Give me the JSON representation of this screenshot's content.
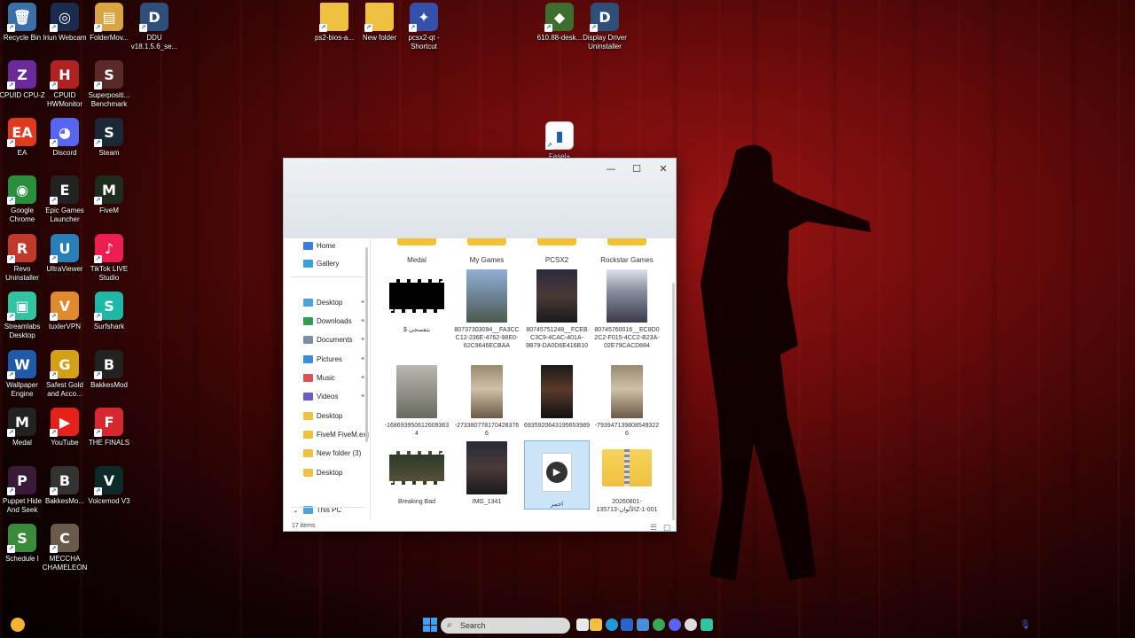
{
  "desktop": {
    "icons": [
      {
        "label": "Recycle Bin",
        "color": "#3b6fa8",
        "glyph": "🗑"
      },
      {
        "label": "Iriun Webcam",
        "color": "#1a2b4d",
        "glyph": "◎"
      },
      {
        "label": "FolderMov...",
        "color": "#d9a441",
        "glyph": "▤"
      },
      {
        "label": "DDU v18.1.5.6_se...",
        "color": "#2d4f7a",
        "glyph": "D"
      },
      {
        "label": "ps2-bios-a...",
        "color": "#f0c040",
        "glyph": ""
      },
      {
        "label": "New folder",
        "color": "#f0c040",
        "glyph": ""
      },
      {
        "label": "pcsx2-qt - Shortcut",
        "color": "#3450a8",
        "glyph": "✦"
      },
      {
        "label": "610.88-desk...",
        "color": "#3d6e2e",
        "glyph": "◆"
      },
      {
        "label": "Display Driver Uninstaller",
        "color": "#2d4f7a",
        "glyph": "D"
      },
      {
        "label": "CPUID CPU-Z",
        "color": "#6a2a9a",
        "glyph": "Z"
      },
      {
        "label": "CPUID HWMonitor",
        "color": "#b02222",
        "glyph": "H"
      },
      {
        "label": "Superpositi... Benchmark",
        "color": "#5a2a2a",
        "glyph": "S"
      },
      {
        "label": "EA",
        "color": "#e03a1e",
        "glyph": "EA"
      },
      {
        "label": "Discord",
        "color": "#5865f2",
        "glyph": "◕"
      },
      {
        "label": "Steam",
        "color": "#1b2838",
        "glyph": "S"
      },
      {
        "label": "Google Chrome",
        "color": "#2a8f3c",
        "glyph": "◉"
      },
      {
        "label": "Epic Games Launcher",
        "color": "#222222",
        "glyph": "E"
      },
      {
        "label": "FiveM",
        "color": "#1e2b1e",
        "glyph": "M"
      },
      {
        "label": "Revo Uninstaller",
        "color": "#c0392b",
        "glyph": "R"
      },
      {
        "label": "UltraViewer",
        "color": "#2980b9",
        "glyph": "U"
      },
      {
        "label": "TikTok LIVE Studio",
        "color": "#ee1d52",
        "glyph": "♪"
      },
      {
        "label": "Streamlabs Desktop",
        "color": "#31c3a2",
        "glyph": "▣"
      },
      {
        "label": "tuxlerVPN",
        "color": "#e08a2c",
        "glyph": "V"
      },
      {
        "label": "Surfshark",
        "color": "#1eb8a6",
        "glyph": "S"
      },
      {
        "label": "Wallpaper Engine",
        "color": "#1e5aa8",
        "glyph": "W"
      },
      {
        "label": "Safest Gold and Acco...",
        "color": "#d4a017",
        "glyph": "G"
      },
      {
        "label": "BakkesMod",
        "color": "#222222",
        "glyph": "B"
      },
      {
        "label": "Medal",
        "color": "#222222",
        "glyph": "M"
      },
      {
        "label": "YouTube",
        "color": "#e62117",
        "glyph": "▶"
      },
      {
        "label": "THE FINALS",
        "color": "#d8282f",
        "glyph": "F"
      },
      {
        "label": "Puppet Hide And Seek",
        "color": "#3a1a3a",
        "glyph": "P"
      },
      {
        "label": "BakkesMo...",
        "color": "#333333",
        "glyph": "B"
      },
      {
        "label": "Voicemod V3",
        "color": "#0d2a2a",
        "glyph": "V"
      },
      {
        "label": "Schedule I",
        "color": "#3a8a3a",
        "glyph": "S"
      },
      {
        "label": "MECCHA CHAMELEON",
        "color": "#6a5a4a",
        "glyph": "C"
      },
      {
        "label": "Fasel+",
        "color": "#ffffff",
        "glyph": "▮"
      }
    ]
  },
  "explorer": {
    "nav": [
      {
        "label": "Home",
        "color": "#3b7be0",
        "pinned": false
      },
      {
        "label": "Gallery",
        "color": "#3aa0d8",
        "pinned": false
      },
      {
        "label": "Desktop",
        "color": "#4aa3df",
        "pinned": true
      },
      {
        "label": "Downloads",
        "color": "#2e9d52",
        "pinned": true
      },
      {
        "label": "Documents",
        "color": "#7a8ea8",
        "pinned": true
      },
      {
        "label": "Pictures",
        "color": "#3a8fd0",
        "pinned": true
      },
      {
        "label": "Music",
        "color": "#d9534f",
        "pinned": true
      },
      {
        "label": "Videos",
        "color": "#6a5acd",
        "pinned": true
      },
      {
        "label": "Desktop",
        "color": "#f0c040",
        "pinned": false
      },
      {
        "label": "FiveM FiveM.exe",
        "color": "#f0c040",
        "pinned": false
      },
      {
        "label": "New folder (3)",
        "color": "#f0c040",
        "pinned": false
      },
      {
        "label": "Desktop",
        "color": "#f0c040",
        "pinned": false
      },
      {
        "label": "This PC",
        "color": "#4aa3df",
        "pinned": false
      }
    ],
    "folders_top": [
      "Medal",
      "My Games",
      "PCSX2",
      "Rockstar Games"
    ],
    "items": [
      {
        "label": "$ بتفسجي",
        "thumb": "film-black"
      },
      {
        "label": "80737303094__FA3CCC12-236E-4762-98E0-62C9646ECBAA",
        "thumb": "photo-sky"
      },
      {
        "label": "80745751248__FCEBC3C9-4CAC-401A-9B79-DA0D6E416B10",
        "thumb": "photo-dark"
      },
      {
        "label": "80745760016__EC8D02C2-F015-4CC2-B23A-02E79CACD884",
        "thumb": "photo-room"
      },
      {
        "label": "-1686939506126093634",
        "thumb": "photo-gray"
      },
      {
        "label": "-2733807781704283766",
        "thumb": "photo-person"
      },
      {
        "label": "6935920643195653989",
        "thumb": "photo-face"
      },
      {
        "label": "-7939471398085493226",
        "thumb": "photo-person"
      },
      {
        "label": "Breaking Bad",
        "thumb": "film-green"
      },
      {
        "label": "IMG_1341",
        "thumb": "photo-dark"
      },
      {
        "label": "احمر",
        "thumb": "video-play"
      },
      {
        "label": "20260801-الألوان-135713Z-1-001",
        "thumb": "zip-folder"
      }
    ],
    "status": "17 items"
  },
  "taskbar": {
    "search_placeholder": "Search"
  }
}
